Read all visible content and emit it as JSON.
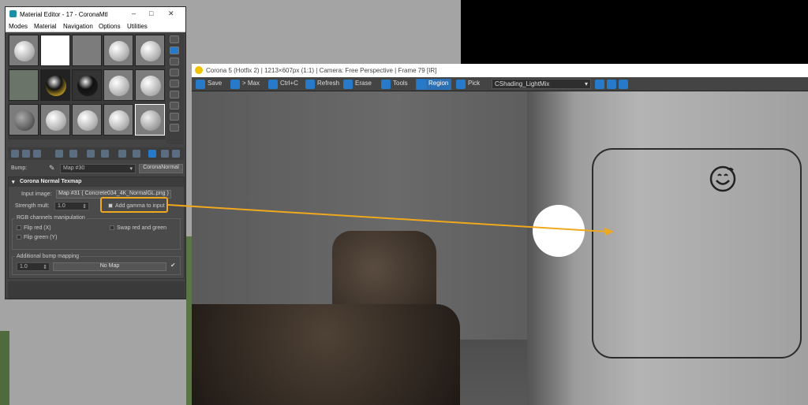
{
  "material_editor": {
    "title": "Material Editor - 17 - CoronaMtl",
    "menu": [
      "Modes",
      "Material",
      "Navigation",
      "Options",
      "Utilities"
    ],
    "bump_label": "Bump:",
    "bump_map": "Map #30",
    "bump_type": "CoronaNormal",
    "rollout_title": "Corona Normal Texmap",
    "input_image_label": "Input image:",
    "input_image_value": "Map #31 ( Concrete034_4K_NormalGL.png )",
    "strength_label": "Strength mult:",
    "strength_value": "1.0",
    "add_gamma_label": "Add gamma to input",
    "rgb_group": "RGB channels manipulation",
    "flip_red": "Flip red (X)",
    "flip_green": "Flip green (Y)",
    "swap_rg": "Swap red and green",
    "additional_bump": "Additional bump mapping",
    "additional_value": "1.0",
    "no_map": "No Map"
  },
  "corona": {
    "title": "Corona 5 (Hotfix 2) | 1213×607px (1:1) | Camera: Free Perspective | Frame 79 [IR]",
    "toolbar": [
      "Save",
      "> Max",
      "Ctrl+C",
      "Refresh",
      "Erase",
      "Tools",
      "Region",
      "Pick"
    ],
    "active_tool": "Region",
    "dropdown": "CShading_LightMix"
  },
  "colors": {
    "highlight": "#f0a81e",
    "accent": "#2b6fb5"
  }
}
